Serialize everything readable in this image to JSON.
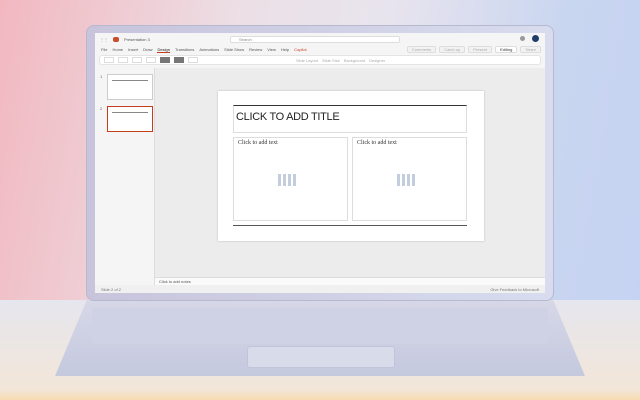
{
  "app": {
    "file_name": "Presentation 3",
    "search_placeholder": "Search"
  },
  "menu": [
    "File",
    "Home",
    "Insert",
    "Draw",
    "Design",
    "Transitions",
    "Animations",
    "Slide Show",
    "Review",
    "View",
    "Help",
    "Copilot"
  ],
  "active_tab": "Design",
  "right_buttons": {
    "comments": "Comments",
    "catch_up": "Catch up",
    "present": "Present",
    "editing": "Editing",
    "share": "Share"
  },
  "ribbon": {
    "slide_layout": "Slide Layout",
    "slide_size": "Slide Size",
    "background": "Background",
    "designer": "Designer"
  },
  "thumbnails": [
    {
      "number": "1"
    },
    {
      "number": "2"
    }
  ],
  "slide": {
    "title": "CLICK TO ADD TITLE",
    "left_text": "Click to add text",
    "right_text": "Click to add text"
  },
  "notes": "Click to add notes",
  "status": {
    "slide": "Slide 2 of 2",
    "feedback": "Give Feedback to Microsoft"
  },
  "colors": {
    "accent": "#c43e1c",
    "avatar": "#1f3d6b"
  }
}
